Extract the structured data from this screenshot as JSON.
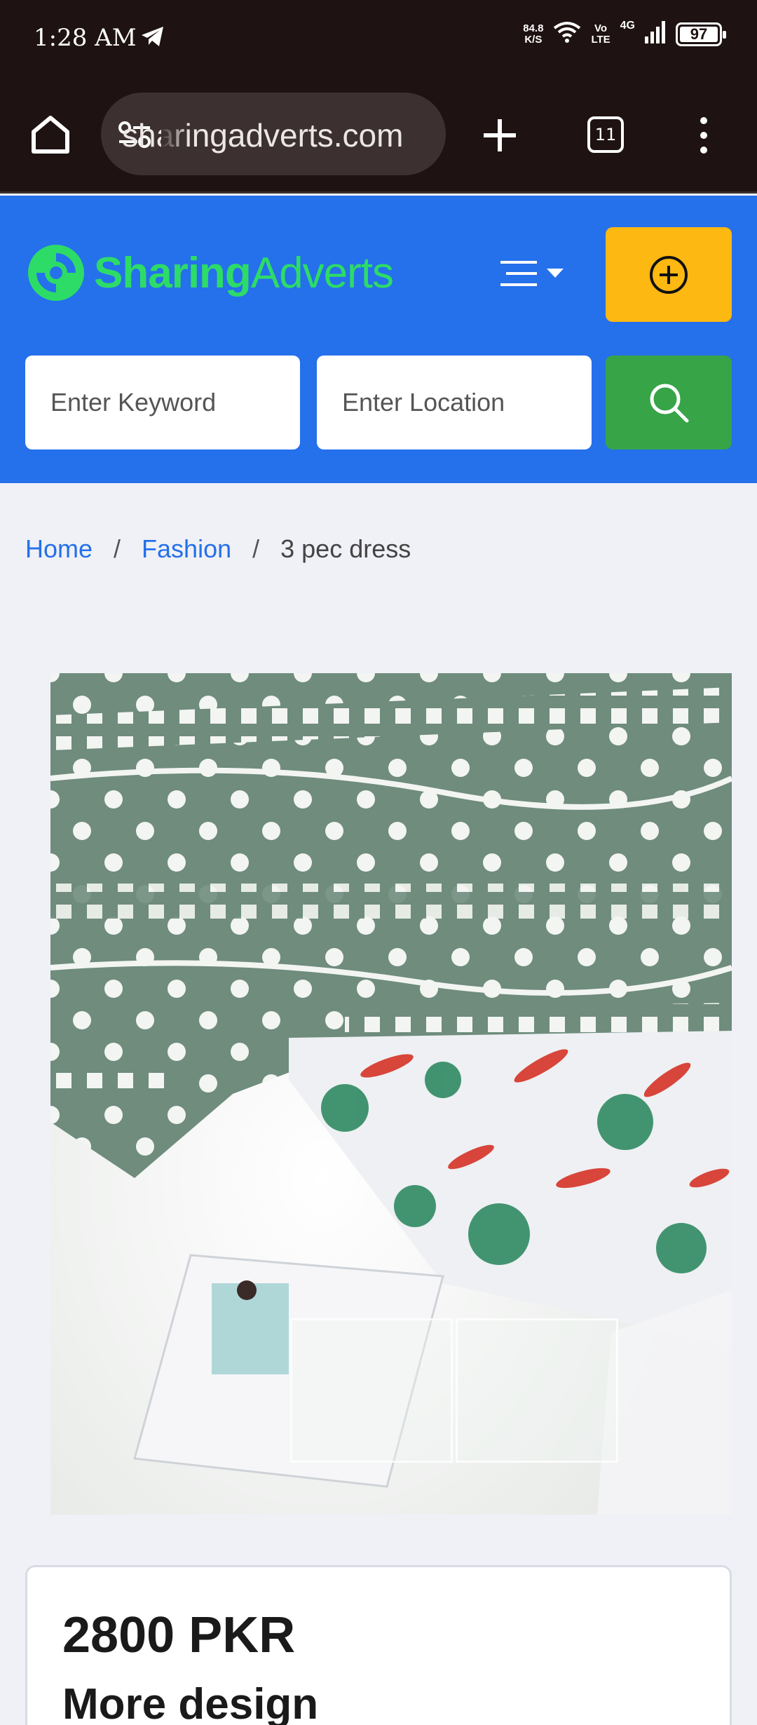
{
  "status_bar": {
    "time": "1:28 AM",
    "net_speed_value": "84.8",
    "net_speed_unit": "K/S",
    "volte_top": "Vo",
    "volte_bottom": "LTE",
    "network": "4G",
    "battery": "97"
  },
  "browser": {
    "url": "sharingadverts.com",
    "tab_count": "11"
  },
  "site": {
    "logo_part1": "Sharing",
    "logo_part2": "Adverts",
    "brand_green": "#2ddc66",
    "header_color": "#2570eb",
    "post_button_color": "#fdb812",
    "search_button_color": "#36a447"
  },
  "search": {
    "keyword_placeholder": "Enter Keyword",
    "location_placeholder": "Enter Location"
  },
  "breadcrumb": {
    "home": "Home",
    "separator": "/",
    "category": "Fashion",
    "current": "3 pec dress"
  },
  "listing": {
    "price": "2800 PKR",
    "title": "More design"
  }
}
